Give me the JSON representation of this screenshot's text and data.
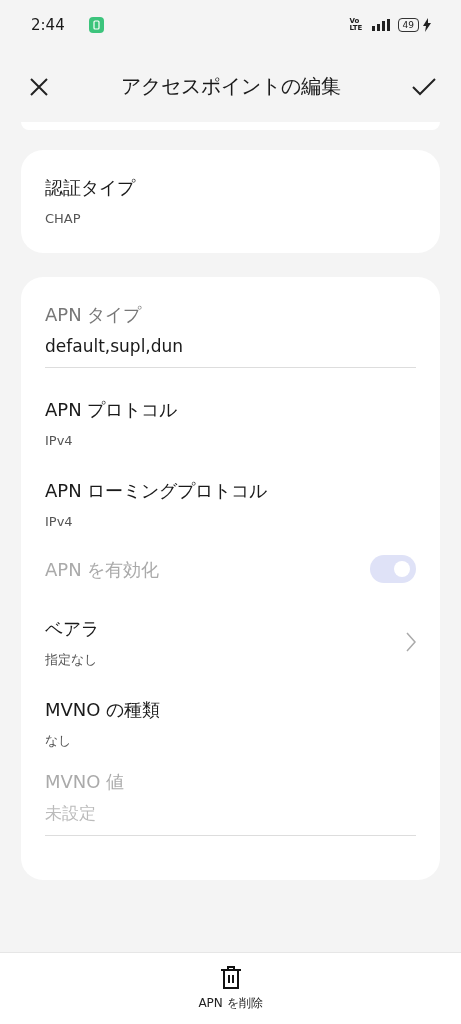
{
  "status_bar": {
    "time": "2:44",
    "network_label": "Vo LTE",
    "battery": "49"
  },
  "header": {
    "title": "アクセスポイントの編集"
  },
  "auth_card": {
    "title": "認証タイプ",
    "summary": "CHAP"
  },
  "settings": [
    {
      "kind": "field",
      "label": "APN タイプ",
      "value": "default,supl,dun",
      "disabled": false
    },
    {
      "kind": "pref",
      "title": "APN プロトコル",
      "summary": "IPv4",
      "disabled": false
    },
    {
      "kind": "pref",
      "title": "APN ローミングプロトコル",
      "summary": "IPv4",
      "disabled": false
    },
    {
      "kind": "switch",
      "title": "APN を有効化",
      "on": true,
      "disabled": true
    },
    {
      "kind": "chevron",
      "title": "ベアラ",
      "summary": "指定なし",
      "disabled": false
    },
    {
      "kind": "pref",
      "title": "MVNO の種類",
      "summary": "なし",
      "disabled": false
    },
    {
      "kind": "field",
      "label": "MVNO 値",
      "placeholder": "未設定",
      "disabled": true
    }
  ],
  "bottom_action": {
    "label": "APN を削除"
  }
}
